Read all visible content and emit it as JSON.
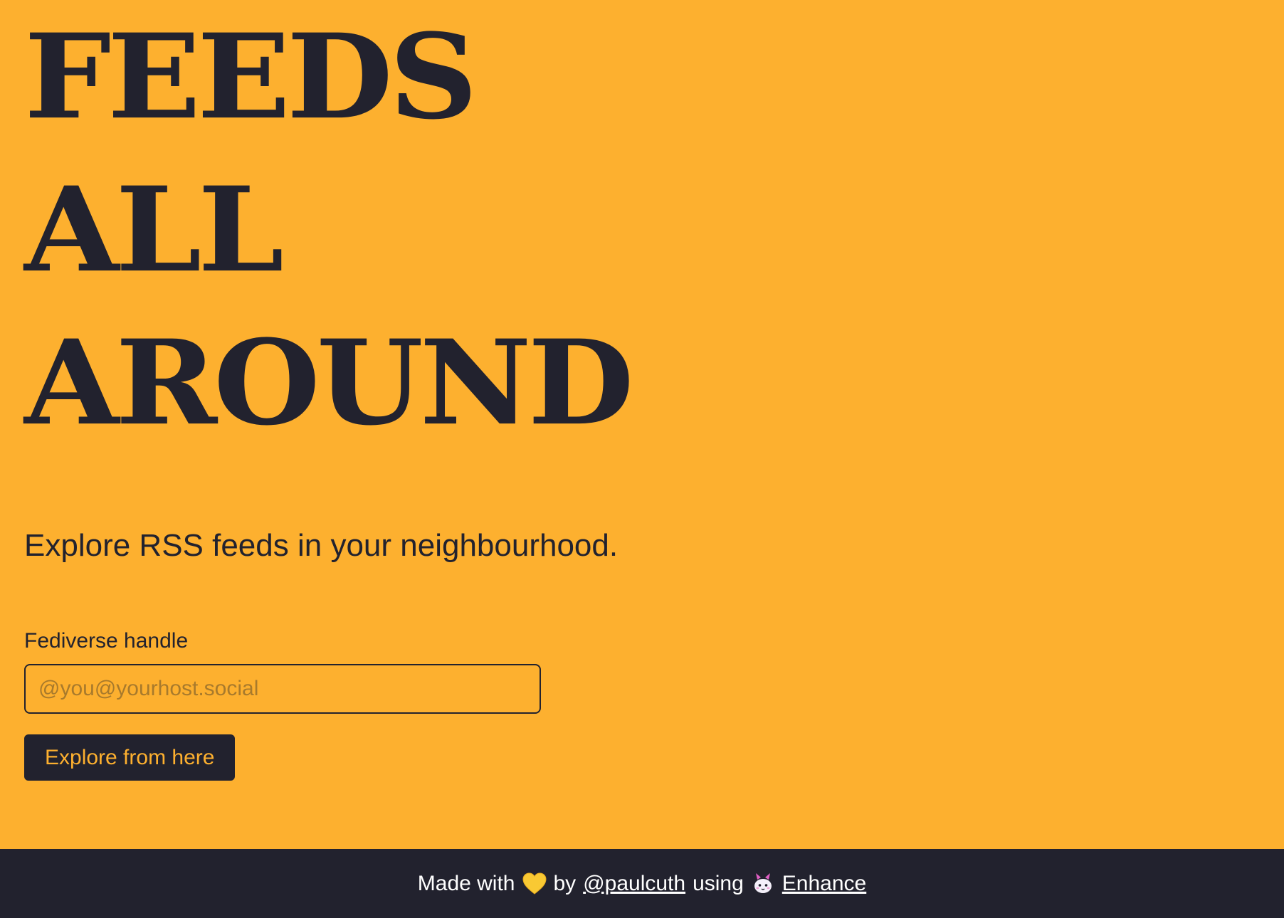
{
  "hero": {
    "title_lines": [
      "FEEDS",
      "ALL",
      "AROUND"
    ],
    "tagline": "Explore RSS feeds in your neighbourhood."
  },
  "form": {
    "label": "Fediverse handle",
    "input_value": "",
    "input_placeholder": "@you@yourhost.social",
    "submit_label": "Explore from here"
  },
  "footer": {
    "made_with": "Made with",
    "heart_icon": "yellow-heart-icon",
    "by": "by",
    "author_link": "@paulcuth",
    "using": "using",
    "enhance_icon": "enhance-logo-icon",
    "enhance_link": "Enhance"
  },
  "colors": {
    "background": "#FDB02F",
    "ink": "#22222E",
    "footer_text": "#FFFFFF",
    "heart": "#F9C933"
  }
}
